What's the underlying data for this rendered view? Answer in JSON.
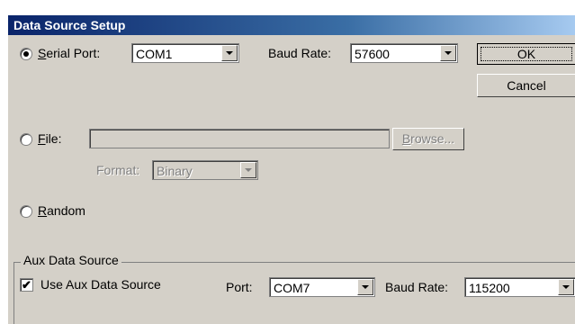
{
  "window": {
    "title": "Data Source Setup"
  },
  "serial": {
    "radio_mnemonic": "S",
    "radio_label_rest": "erial Port:",
    "port_value": "COM1",
    "baud_label": "Baud Rate:",
    "baud_value": "57600",
    "selected": true
  },
  "buttons": {
    "ok": "OK",
    "cancel": "Cancel",
    "browse_mnemonic": "B",
    "browse_rest": "rowse..."
  },
  "file": {
    "radio_mnemonic": "F",
    "radio_label_rest": "ile:",
    "path_value": "",
    "format_label": "Format:",
    "format_value": "Binary",
    "selected": false
  },
  "random": {
    "radio_mnemonic": "R",
    "radio_label_rest": "andom",
    "selected": false
  },
  "aux": {
    "group_title": "Aux Data Source",
    "checkbox_label": "Use Aux Data Source",
    "checked": true,
    "port_label": "Port:",
    "port_value": "COM7",
    "baud_label": "Baud Rate:",
    "baud_value": "115200"
  },
  "icons": {
    "radio_selected": "radio-selected-icon",
    "checkmark": "checkmark-icon",
    "dropdown_arrow": "chevron-down-icon"
  },
  "colors": {
    "title_bar": "#0a246a",
    "dialog_bg": "#d4d0c8",
    "disabled_text": "#808080"
  }
}
